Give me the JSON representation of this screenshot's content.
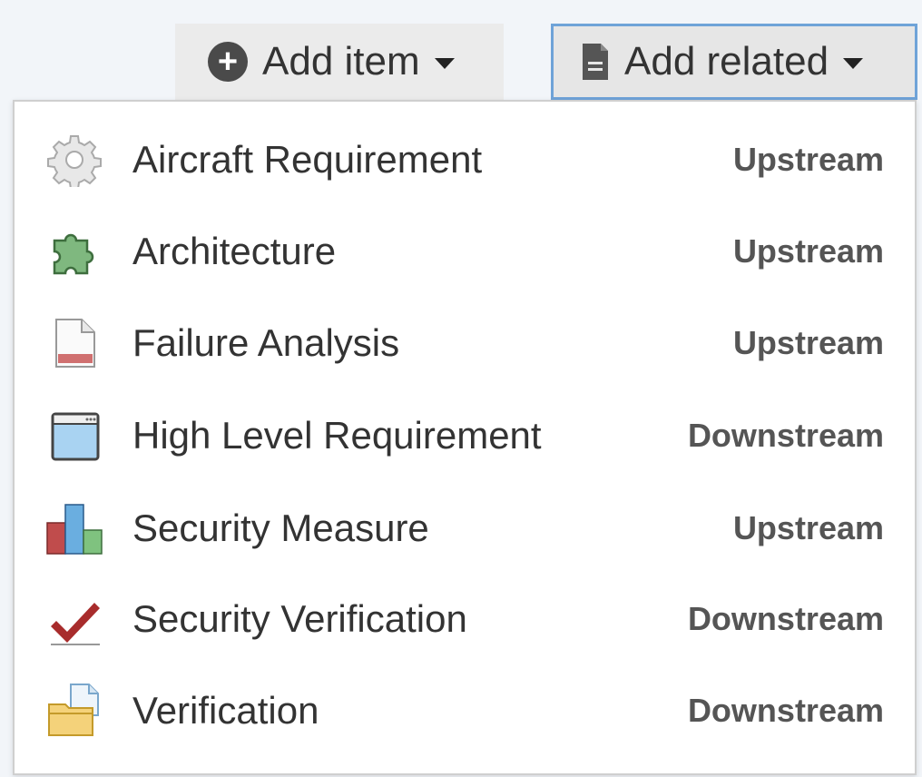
{
  "toolbar": {
    "add_item_label": "Add item",
    "add_related_label": "Add related"
  },
  "menu": {
    "items": [
      {
        "label": "Aircraft Requirement",
        "direction": "Upstream",
        "icon": "gear-icon"
      },
      {
        "label": "Architecture",
        "direction": "Upstream",
        "icon": "puzzle-icon"
      },
      {
        "label": "Failure Analysis",
        "direction": "Upstream",
        "icon": "document-icon"
      },
      {
        "label": "High Level Requirement",
        "direction": "Downstream",
        "icon": "window-icon"
      },
      {
        "label": "Security Measure",
        "direction": "Upstream",
        "icon": "bar-chart-icon"
      },
      {
        "label": "Security Verification",
        "direction": "Downstream",
        "icon": "checkmark-icon"
      },
      {
        "label": "Verification",
        "direction": "Downstream",
        "icon": "folder-document-icon"
      }
    ]
  },
  "colors": {
    "accent_border": "#6fa3d8",
    "puzzle_green": "#7fb87f",
    "window_blue": "#a9d3f2",
    "chart_red": "#c04c4c",
    "chart_blue": "#6aaee0",
    "chart_green": "#7fc27f",
    "check_red": "#a82c2c",
    "folder_yellow": "#f4d27a"
  }
}
